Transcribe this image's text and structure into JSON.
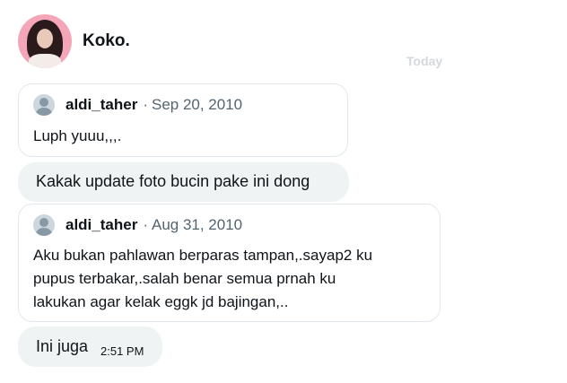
{
  "conversation": {
    "sender_name": "Koko.",
    "date_separator": "Today"
  },
  "messages": [
    {
      "type": "quote",
      "username": "aldi_taher",
      "separator": "·",
      "date": "Sep 20, 2010",
      "text": "Luph yuuu,,,."
    },
    {
      "type": "text",
      "text": "Kakak update foto bucin pake ini dong"
    },
    {
      "type": "quote",
      "username": "aldi_taher",
      "separator": "·",
      "date": "Aug 31, 2010",
      "lines": [
        "Aku bukan pahlawan berparas tampan,.sayap2 ku",
        "pupus terbakar,.salah benar semua prnah ku",
        "lakukan agar kelak eggk jd bajingan,.."
      ]
    },
    {
      "type": "text",
      "text": "Ini juga",
      "time": "2:51 PM"
    }
  ]
}
